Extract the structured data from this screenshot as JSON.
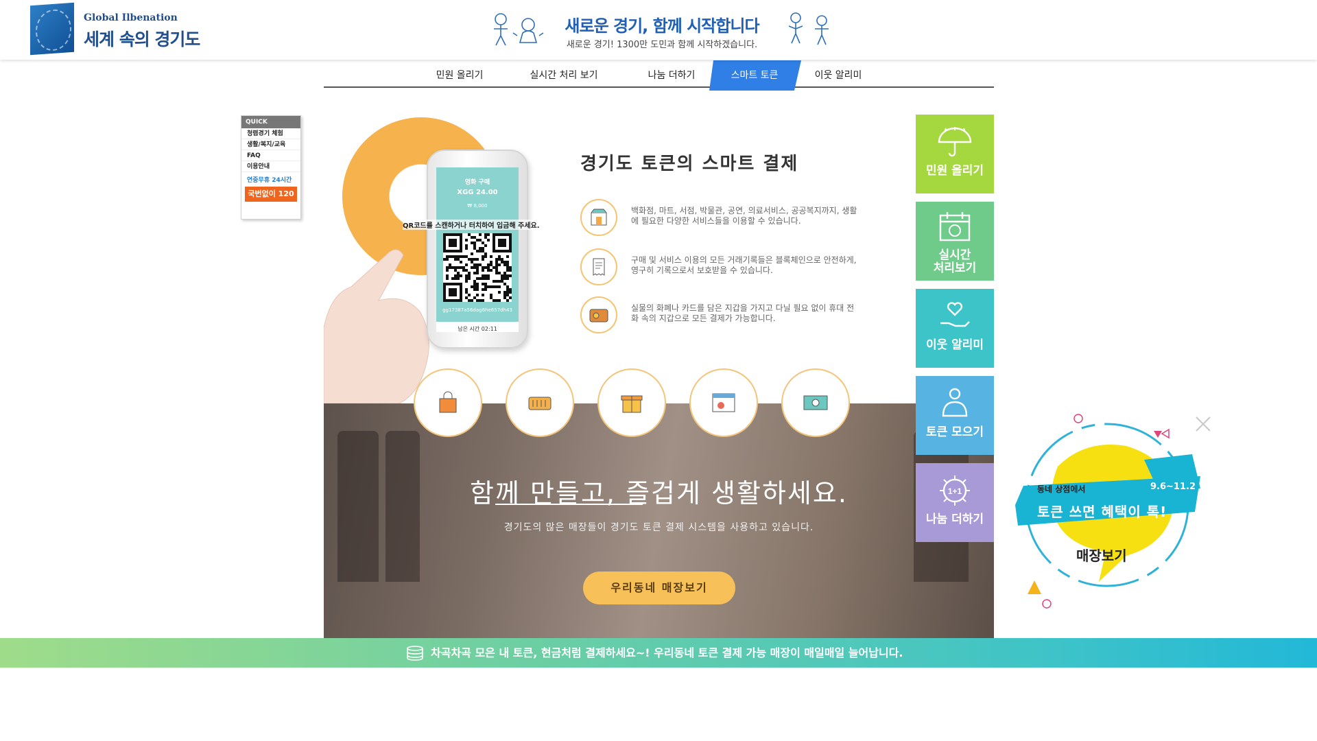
{
  "header": {
    "logo_sub": "Global Ilbenation",
    "logo_main": "세계 속의 경기도",
    "banner_title": "새로운 경기, 함께 시작합니다",
    "banner_sub": "새로운 경기! 1300만 도민과 함께 시작하겠습니다."
  },
  "nav": {
    "items": [
      {
        "label": "민원 올리기"
      },
      {
        "label": "실시간 처리 보기"
      },
      {
        "label": "나눔 더하기"
      },
      {
        "label": "스마트 토큰",
        "active": true
      },
      {
        "label": "이웃 알리미"
      }
    ],
    "active_color": "#2f7fe6"
  },
  "quick": {
    "title": "QUICK",
    "items": [
      "청렴경기 체험",
      "생활/복지/교육",
      "FAQ",
      "이용안내"
    ],
    "hotline_label": "연중무휴 24시간",
    "hotline_button": "국번없이 120"
  },
  "phone": {
    "header": "영화 구매",
    "amount": "XGG 24.00",
    "price": "₩ 8,000",
    "instruction": "QR코드를 스캔하거나 터치하여 입금해 주세요.",
    "hash": "gg17387a56dag6he657dh43",
    "time_left": "남은 시간 02:11"
  },
  "main": {
    "title": "경기도 토큰의 스마트 결제",
    "features": [
      {
        "icon": "shop-icon",
        "text": "백화점, 마트, 서점, 박물관, 공연, 의료서비스, 공공복지까지, 생활에 필요한 다양한 서비스들을 이용할 수 있습니다."
      },
      {
        "icon": "receipt-icon",
        "text": "구매 및 서비스 이용의 모든 거래기록들은 블록체인으로 안전하게, 영구히 기록으로서 보호받을 수 있습니다."
      },
      {
        "icon": "wallet-icon",
        "text": "실물의 화폐나 카드를 담은 지갑을 가지고 다닐 필요 없이 휴대 전화 속의 지갑으로 모든 결제가 가능합니다."
      }
    ],
    "categories": [
      "shopping-bag-icon",
      "market-basket-icon",
      "gift-icon",
      "culture-icon",
      "cash-icon"
    ]
  },
  "photo": {
    "title": "함께 만들고, 즐겁게 생활하세요.",
    "subtitle": "경기도의 많은 매장들이 경기도 토큰 결제 시스템을 사용하고 있습니다.",
    "button": "우리동네 매장보기"
  },
  "tiles": [
    {
      "lines": [
        "민원 올리기"
      ],
      "color": "#a5d83f",
      "icon": "umbrella-icon"
    },
    {
      "lines": [
        "실시간",
        "처리보기"
      ],
      "color": "#6fcb8a",
      "icon": "calendar-icon"
    },
    {
      "lines": [
        "이웃 알리미"
      ],
      "color": "#3cc4c8",
      "icon": "heart-hand-icon"
    },
    {
      "lines": [
        "토큰 모으기"
      ],
      "color": "#56b3e2",
      "icon": "coin-bag-icon"
    },
    {
      "lines": [
        "나눔 더하기"
      ],
      "color": "#a79ad6",
      "icon": "plus-one-icon"
    }
  ],
  "promo": {
    "label": "동네 상점에서",
    "dates": "9.6~11.2",
    "headline": "토큰 쓰면 혜택이 톡!",
    "button": "매장보기"
  },
  "bottom_bar": {
    "text": "차곡차곡 모은 내 토큰, 현금처럼 결제하세요~! 우리동네 토큰 결제 가능 매장이 매일매일 늘어납니다."
  }
}
